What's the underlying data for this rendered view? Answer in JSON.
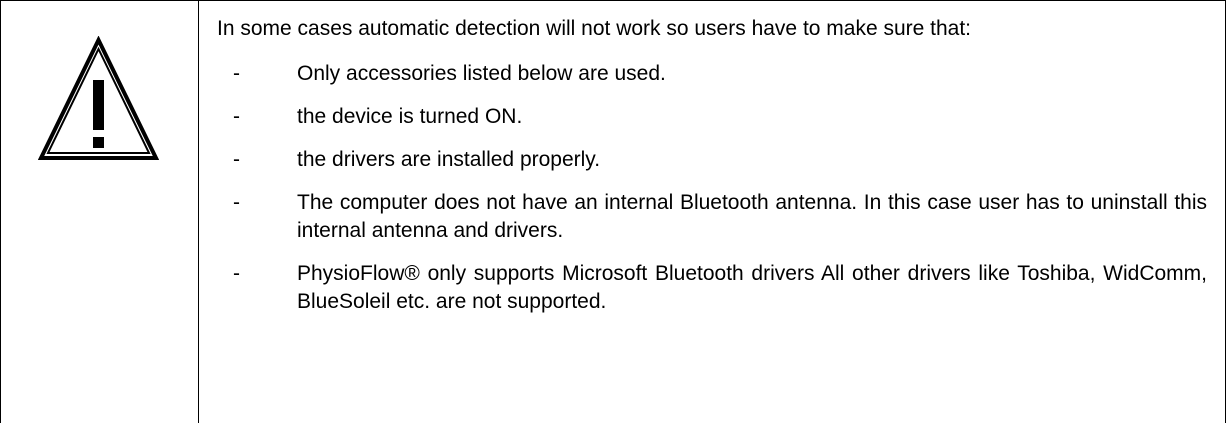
{
  "notice": {
    "icon": "warning-exclamation-triangle-icon",
    "intro": "In some cases automatic detection will not work so users have to make sure that:",
    "dash_marker": "-",
    "items": [
      {
        "text": "Only accessories listed below are used."
      },
      {
        "text": "the device is turned ON."
      },
      {
        "text": "the drivers are installed properly."
      },
      {
        "text": "The computer does not have an internal Bluetooth antenna. In this case user has to uninstall this internal antenna and drivers."
      },
      {
        "text": "PhysioFlow® only supports Microsoft Bluetooth drivers All other drivers like Toshiba, WidComm, BlueSoleil etc. are not supported."
      }
    ]
  }
}
